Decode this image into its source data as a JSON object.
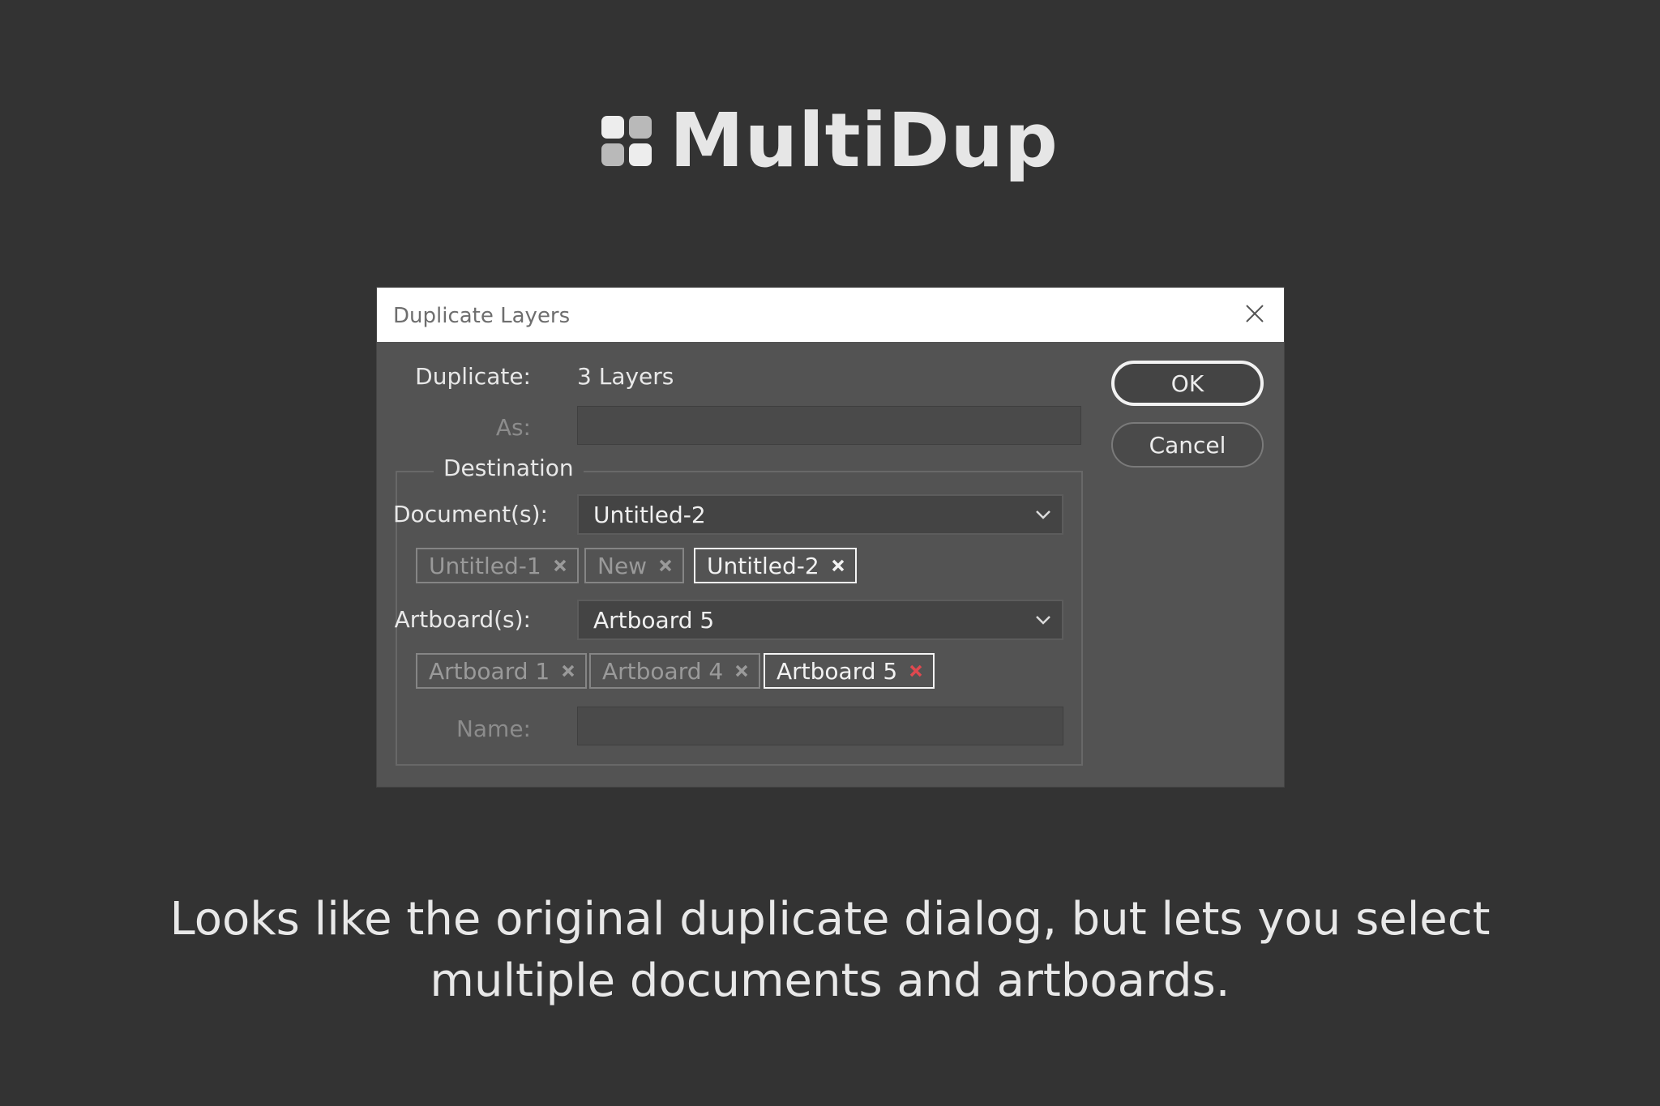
{
  "brand": {
    "title": "MultiDup"
  },
  "dialog": {
    "title": "Duplicate Layers",
    "duplicate_label": "Duplicate:",
    "duplicate_value": "3 Layers",
    "as_label": "As:",
    "as_value": "",
    "destination_legend": "Destination",
    "documents_label": "Document(s):",
    "documents_selected": "Untitled-2",
    "document_chips": [
      {
        "label": "Untitled-1",
        "active": false
      },
      {
        "label": "New",
        "active": false
      },
      {
        "label": "Untitled-2",
        "active": true
      }
    ],
    "artboards_label": "Artboard(s):",
    "artboards_selected": "Artboard 5",
    "artboard_chips": [
      {
        "label": "Artboard 1",
        "active": false
      },
      {
        "label": "Artboard 4",
        "active": false
      },
      {
        "label": "Artboard 5",
        "active": true
      }
    ],
    "name_label": "Name:",
    "name_value": "",
    "ok_label": "OK",
    "cancel_label": "Cancel"
  },
  "caption": {
    "line1": "Looks like the original duplicate dialog, but lets you select",
    "line2": "multiple documents and artboards."
  },
  "colors": {
    "background": "#333333",
    "dialog_body": "#535353",
    "active_artboard_remove": "#e0484f"
  },
  "icons": {
    "brand": "four-squares-logo-icon",
    "close": "close-icon",
    "dropdown": "chevron-down-icon",
    "chip_remove": "x-icon"
  }
}
